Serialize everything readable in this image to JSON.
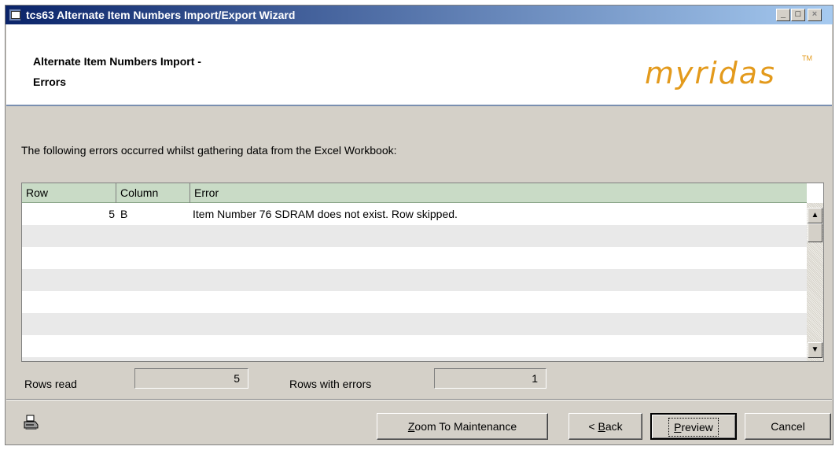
{
  "window": {
    "title": "tcs63 Alternate Item Numbers Import/Export Wizard",
    "controls": {
      "minimize": "_",
      "maximize": "□",
      "close": "×"
    }
  },
  "header": {
    "title_line1": "Alternate Item Numbers Import -",
    "title_line2": "Errors",
    "logo": "myridas",
    "logo_tm": "TM"
  },
  "message": "The following errors occurred whilst gathering data from the Excel Workbook:",
  "grid": {
    "columns": [
      "Row",
      "Column",
      "Error"
    ],
    "rows": [
      {
        "row": "5",
        "column": "B",
        "error": "Item Number 76 SDRAM does not exist. Row skipped."
      }
    ]
  },
  "stats": {
    "rows_read_label": "Rows read",
    "rows_read_value": "5",
    "rows_with_errors_label": "Rows with errors",
    "rows_with_errors_value": "1"
  },
  "buttons": {
    "zoom": {
      "mnemonic": "Z",
      "rest": "oom To Maintenance"
    },
    "back": {
      "prefix": "< ",
      "mnemonic": "B",
      "rest": "ack"
    },
    "preview": {
      "mnemonic": "P",
      "rest": "review"
    },
    "cancel": "Cancel"
  },
  "colors": {
    "title_bar_start": "#0a246a",
    "title_bar_end": "#a6caf0",
    "grid_header": "#c9dbc6",
    "logo": "#e39a1c"
  },
  "icons": {
    "app": "window-app-icon",
    "print": "printer-icon"
  }
}
